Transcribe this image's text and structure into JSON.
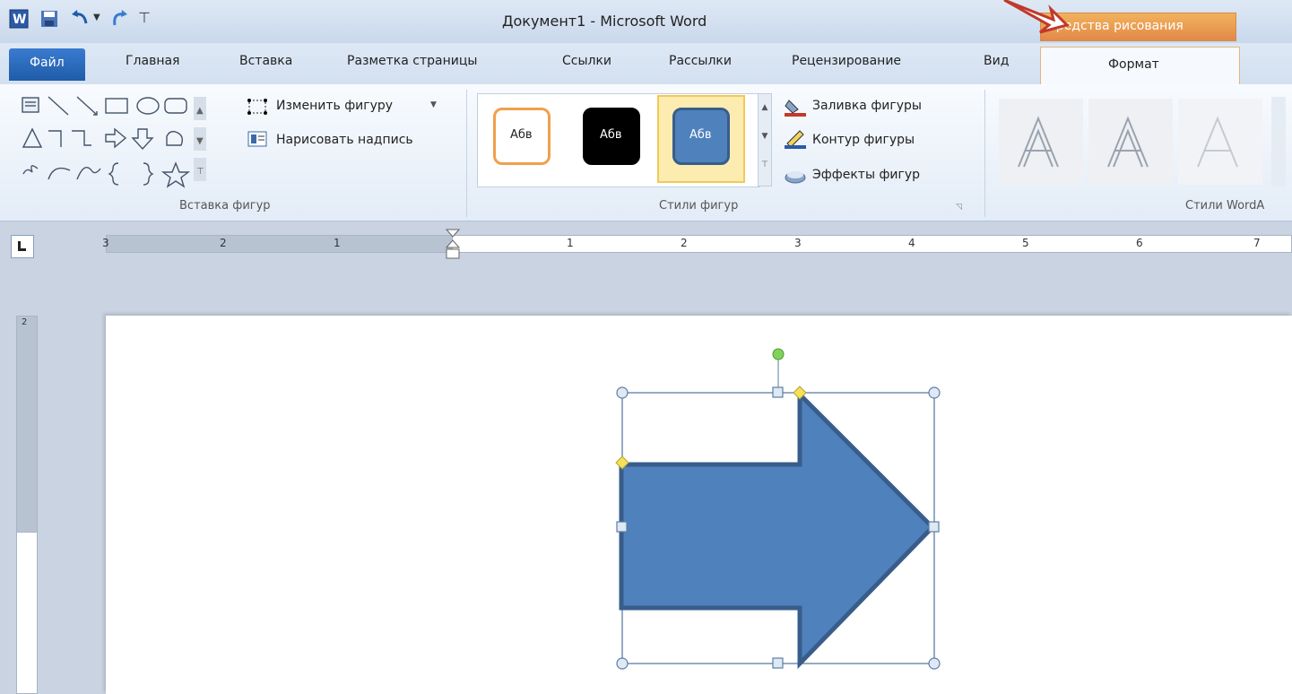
{
  "window": {
    "title": "Документ1  -  Microsoft Word",
    "context_tab": "Средства рисования"
  },
  "quick_access": {
    "icons": [
      "word-app-icon",
      "save-icon",
      "undo-icon",
      "redo-icon",
      "customize-icon"
    ]
  },
  "tabs": {
    "file": "Файл",
    "items": [
      "Главная",
      "Вставка",
      "Разметка страницы",
      "Ссылки",
      "Рассылки",
      "Рецензирование",
      "Вид"
    ],
    "active": "Формат"
  },
  "ribbon": {
    "insert_shapes": {
      "label": "Вставка фигур",
      "edit_shape": "Изменить фигуру",
      "draw_textbox": "Нарисовать надпись"
    },
    "shape_styles": {
      "label": "Стили фигур",
      "styles": [
        {
          "text": "Абв",
          "fill": "#ffffff",
          "border": "#f0a04b",
          "color": "#222222"
        },
        {
          "text": "Абв",
          "fill": "#000000",
          "border": "#000000",
          "color": "#ffffff"
        },
        {
          "text": "Абв",
          "fill": "#4f81bd",
          "border": "#385d8a",
          "color": "#ffffff"
        }
      ],
      "fill": "Заливка фигуры",
      "outline": "Контур фигуры",
      "effects": "Эффекты фигур"
    },
    "wordart_styles": {
      "label": "Стили WordA"
    }
  },
  "ruler": {
    "h_left": [
      "3",
      "2",
      "1"
    ],
    "h_right": [
      "1",
      "2",
      "3",
      "4",
      "5",
      "6",
      "7"
    ],
    "v_top": "2"
  },
  "colors": {
    "accent_blue": "#4f81bd",
    "arrow_outline": "#385d8a",
    "context_orange": "#e2894a"
  }
}
